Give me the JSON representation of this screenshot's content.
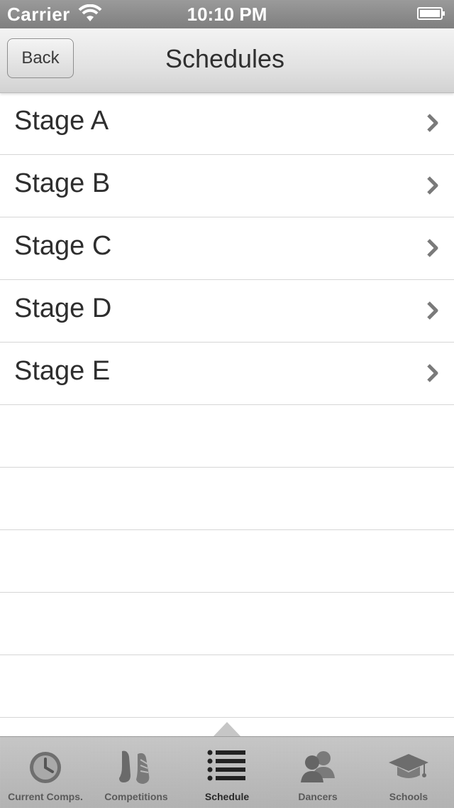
{
  "status_bar": {
    "carrier": "Carrier",
    "time": "10:10 PM",
    "wifi_icon": "wifi-icon",
    "battery_icon": "battery-icon"
  },
  "nav_bar": {
    "back_label": "Back",
    "title": "Schedules"
  },
  "list": {
    "items": [
      {
        "label": "Stage A"
      },
      {
        "label": "Stage B"
      },
      {
        "label": "Stage C"
      },
      {
        "label": "Stage D"
      },
      {
        "label": "Stage E"
      }
    ],
    "chevron_icon": "chevron-right-icon"
  },
  "tab_bar": {
    "selected": "Schedule",
    "tabs": [
      {
        "label": "Current Comps.",
        "icon": "clock-icon"
      },
      {
        "label": "Competitions",
        "icon": "dance-shoes-icon"
      },
      {
        "label": "Schedule",
        "icon": "list-icon"
      },
      {
        "label": "Dancers",
        "icon": "people-icon"
      },
      {
        "label": "Schools",
        "icon": "graduation-cap-icon"
      }
    ]
  },
  "colors": {
    "status_bar": "#8c8c8c",
    "nav_bar": "#e2e2e2",
    "separator": "#d6d6d6",
    "chevron": "#7a7a7a",
    "tab_bar": "#bfbfbf"
  }
}
